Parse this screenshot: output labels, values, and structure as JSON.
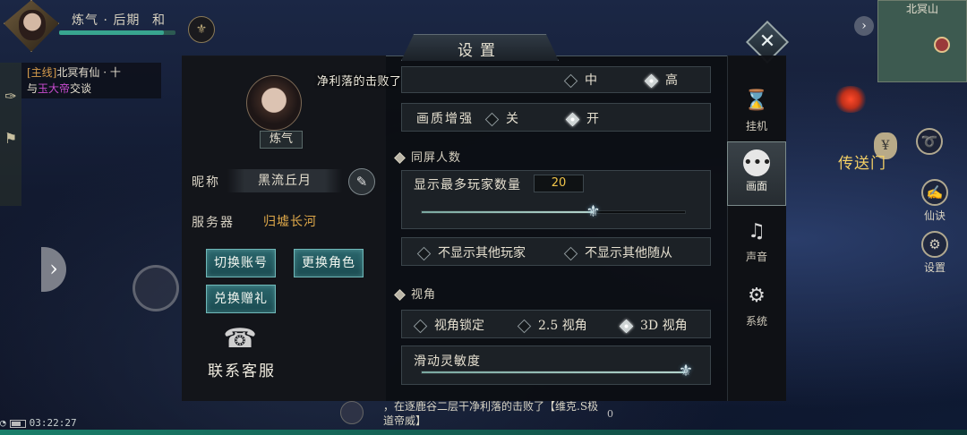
{
  "hud": {
    "player_name": "炼气 · 后期",
    "server_short": "和",
    "emblem_glyph": "⚜",
    "quest_tag": "[主线]",
    "quest_title": "北冥有仙 · 十",
    "quest_pre": "与",
    "quest_who": "玉大帝",
    "quest_post": "交谈",
    "minimap_title": "北冥山",
    "teleport_label": "传送门",
    "side_icons": [
      {
        "glyph": "➰",
        "label": ""
      },
      {
        "glyph": "✍",
        "label": "仙诀"
      },
      {
        "glyph": "⚙",
        "label": "设置"
      }
    ],
    "clock": "03:22:27",
    "chat_message": "，在逐鹿谷二层干净利落的击败了【维克.S极道帝威】",
    "chat_count": "0"
  },
  "settings": {
    "title": "设置",
    "close_glyph": "✕",
    "profile": {
      "level": "炼气",
      "nickname_label": "昵称",
      "nickname": "黑流丘月",
      "edit_glyph": "✎",
      "server_label": "服务器",
      "server_name": "归墟长河"
    },
    "buttons": {
      "switch_account": "切换账号",
      "switch_role": "更换角色",
      "redeem_gift": "兑换赠礼",
      "support": "联系客服",
      "support_glyph": "☎"
    },
    "kill_banner": "净利落的击败了【维克.S极道帝威】",
    "quality": {
      "mid_label": "中",
      "high_label": "高",
      "selected": "高"
    },
    "enhance": {
      "label": "画质增强",
      "off_label": "关",
      "on_label": "开",
      "selected": "开"
    },
    "players_section": {
      "title": "同屏人数",
      "max_label": "显示最多玩家数量",
      "max_value": "20",
      "slider_fraction": 0.65,
      "hide_players": "不显示其他玩家",
      "hide_followers": "不显示其他随从"
    },
    "view_section": {
      "title": "视角",
      "lock": "视角锁定",
      "v25": "2.5 视角",
      "v3d": "3D 视角",
      "selected": "3D 视角",
      "sensitivity_label": "滑动灵敏度",
      "sensitivity_fraction": 1.0
    },
    "tabs": [
      {
        "label": "挂机",
        "glyph": "⌛",
        "active": false
      },
      {
        "label": "画面",
        "glyph": "•••",
        "active": true
      },
      {
        "label": "声音",
        "glyph": "♫",
        "active": false
      },
      {
        "label": "系统",
        "glyph": "⚙",
        "active": false
      }
    ]
  }
}
